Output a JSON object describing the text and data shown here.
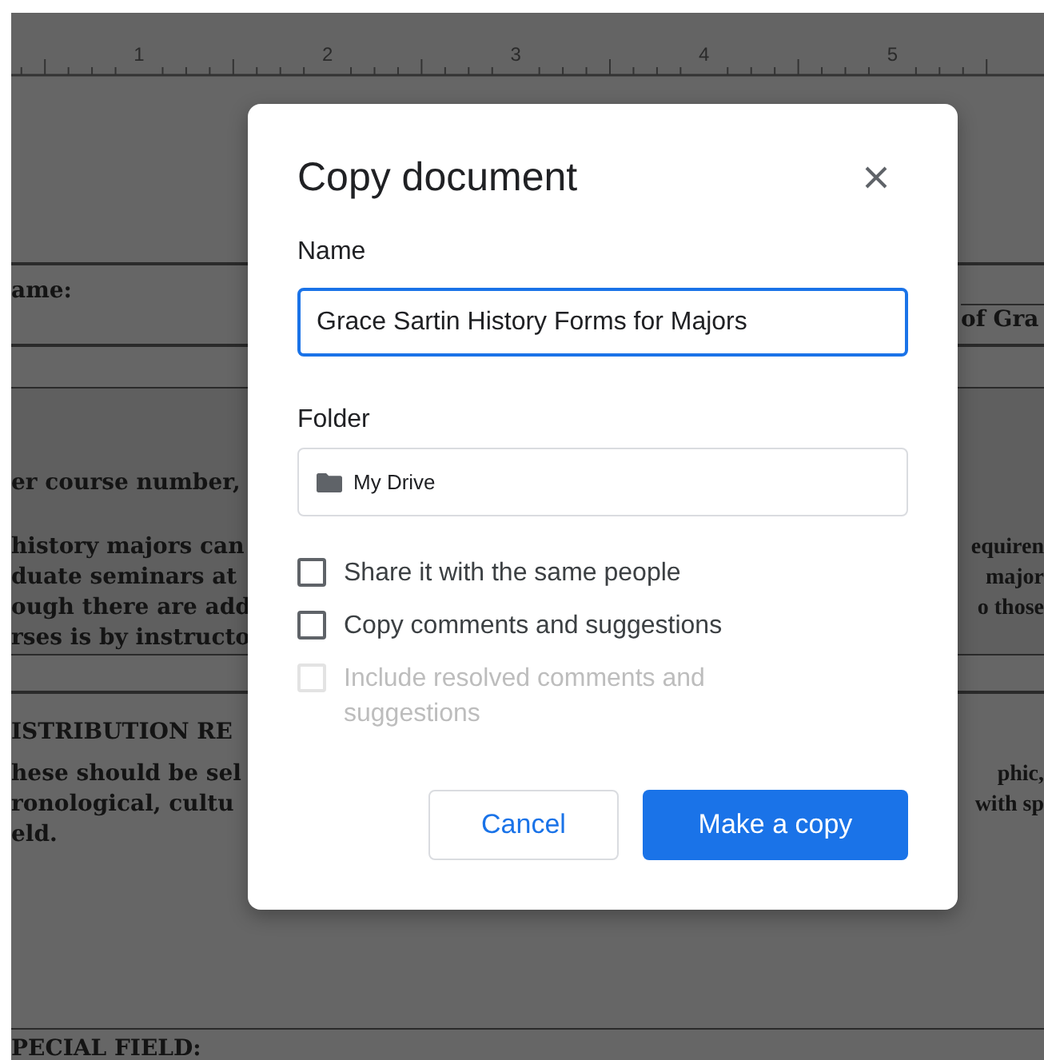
{
  "ruler": {
    "labels": [
      "1",
      "2",
      "3",
      "4",
      "5"
    ]
  },
  "document": {
    "name_label": "ame:",
    "name_right": "of Gra",
    "course_line": "er course number,",
    "lines": [
      {
        "left": "history majors can",
        "right": "equiren"
      },
      {
        "left": "duate seminars at",
        "right": "major"
      },
      {
        "left": "ough there are add",
        "right": "o those"
      },
      {
        "left": "rses is by instructo"
      }
    ],
    "distribution_heading": "ISTRIBUTION RE",
    "distribution_lines": [
      {
        "left": "hese should be sel",
        "right": "phic,"
      },
      {
        "left": "ronological, cultu",
        "right": "with sp"
      },
      {
        "left": "eld."
      }
    ],
    "special_heading": "PECIAL FIELD:"
  },
  "dialog": {
    "title": "Copy document",
    "name_label": "Name",
    "name_value": "Grace Sartin History Forms for Majors",
    "folder_label": "Folder",
    "folder_value": "My Drive",
    "options": [
      {
        "label": "Share it with the same people",
        "checked": false,
        "disabled": false
      },
      {
        "label": "Copy comments and suggestions",
        "checked": false,
        "disabled": false
      },
      {
        "label": "Include resolved comments and suggestions",
        "checked": false,
        "disabled": true
      }
    ],
    "buttons": [
      {
        "label": "Cancel",
        "kind": "secondary"
      },
      {
        "label": "Make a copy",
        "kind": "primary"
      }
    ]
  }
}
